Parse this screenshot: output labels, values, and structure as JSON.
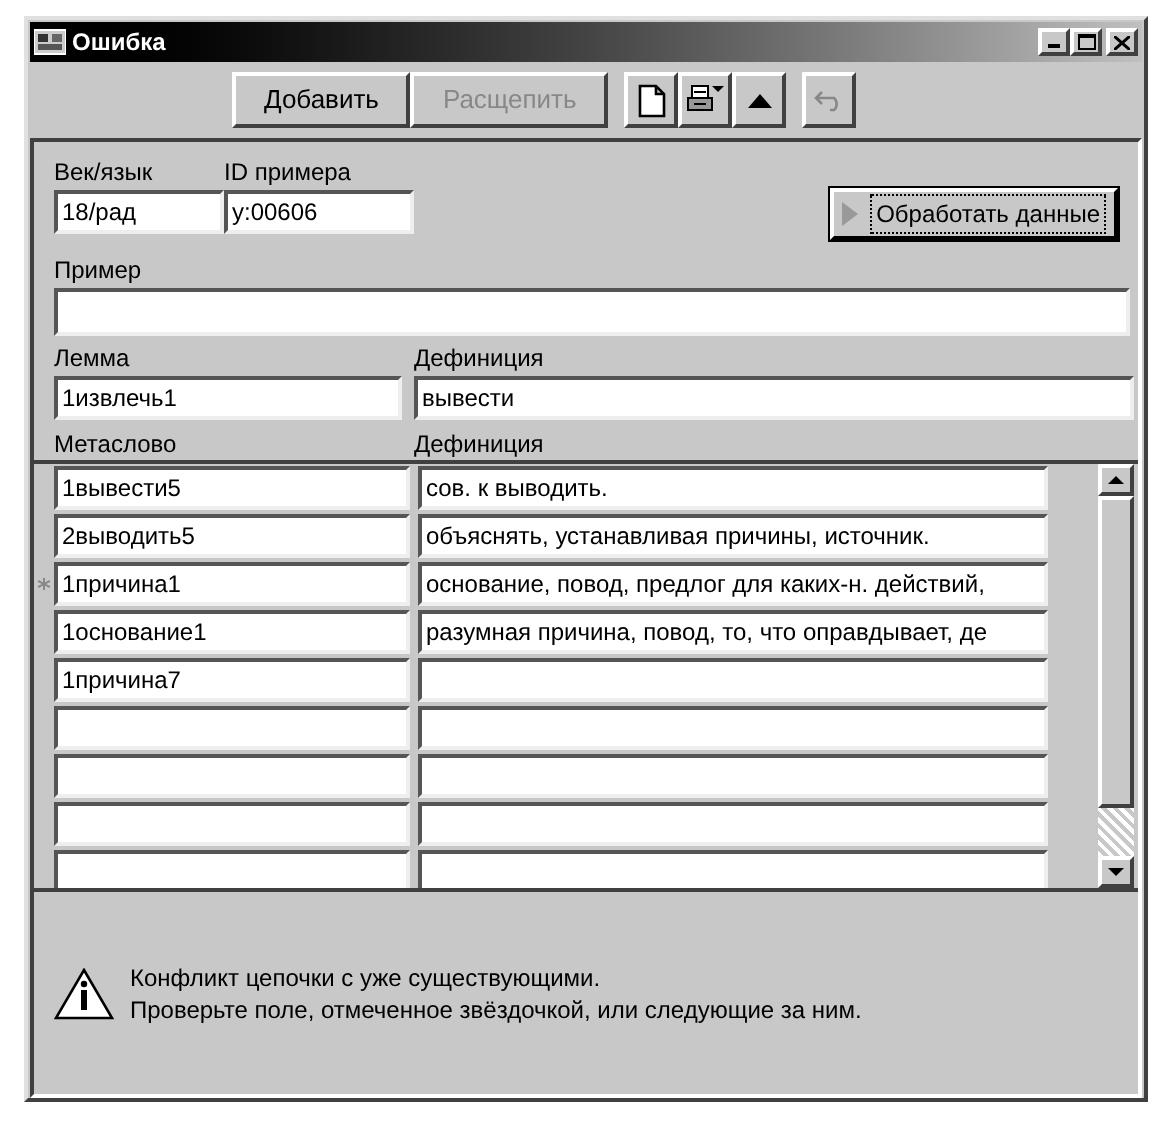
{
  "window": {
    "title": "Ошибка"
  },
  "toolbar": {
    "buttons": [
      {
        "label": "Добавить",
        "disabled": false
      },
      {
        "label": "Расщепить",
        "disabled": true
      }
    ],
    "tool_buttons": [
      {
        "kind": "page",
        "disabled": false
      },
      {
        "kind": "print-menu",
        "disabled": false
      },
      {
        "kind": "up",
        "disabled": false
      },
      {
        "kind": "undo",
        "disabled": true
      }
    ]
  },
  "form": {
    "century_language": {
      "label": "Век/язык",
      "value": "18/рад"
    },
    "example_id": {
      "label": "ID примера",
      "value": "у:00606"
    },
    "process_button": {
      "label": "Обработать данные"
    },
    "example": {
      "label": "Пример"
    },
    "lemma": {
      "label": "Лемма",
      "value": "1извлечь1"
    },
    "definition": {
      "label": "Дефиниция",
      "value": "вывести"
    }
  },
  "table": {
    "columns": [
      "Метаслово",
      "Дефиниция"
    ],
    "rows": [
      {
        "metaword": "1вывести5",
        "definition": "сов. к выводить.",
        "marked": false
      },
      {
        "metaword": "2выводить5",
        "definition": "объяснять, устанавливая причины, источник.",
        "marked": false
      },
      {
        "metaword": "1причина1",
        "definition": "основание, повод, предлог для каких-н. действий,",
        "marked": true
      },
      {
        "metaword": "1основание1",
        "definition": "разумная причина, повод, то, что оправдывает, де",
        "marked": false
      },
      {
        "metaword": "1причина7",
        "marked": false
      },
      {
        "marked": false
      },
      {
        "marked": false
      },
      {
        "marked": false
      },
      {
        "marked": false
      }
    ]
  },
  "status": {
    "lines": [
      "Конфликт цепочки с уже существующими.",
      "Проверьте поле, отмеченное звёздочкой, или следующие за ним."
    ]
  }
}
